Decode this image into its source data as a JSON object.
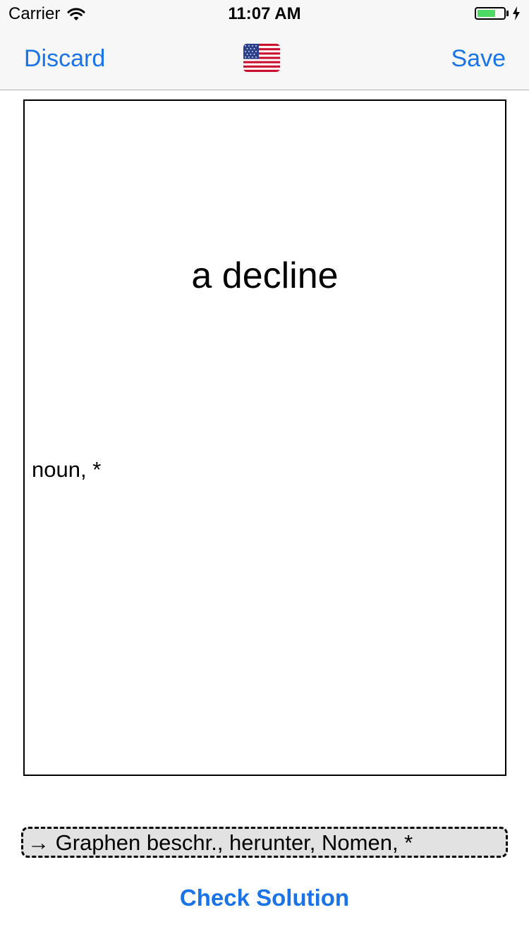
{
  "status_bar": {
    "carrier": "Carrier",
    "time": "11:07 AM",
    "battery_level": 0.7,
    "battery_color": "#4cd964"
  },
  "nav": {
    "left_label": "Discard",
    "right_label": "Save",
    "center_icon": "us-flag-icon",
    "accent": "#1a74e8"
  },
  "card": {
    "word": "a decline",
    "meta": "noun, *"
  },
  "answer": {
    "text": "→ Graphen beschr., herunter, Nomen, *"
  },
  "actions": {
    "check_label": "Check Solution"
  }
}
